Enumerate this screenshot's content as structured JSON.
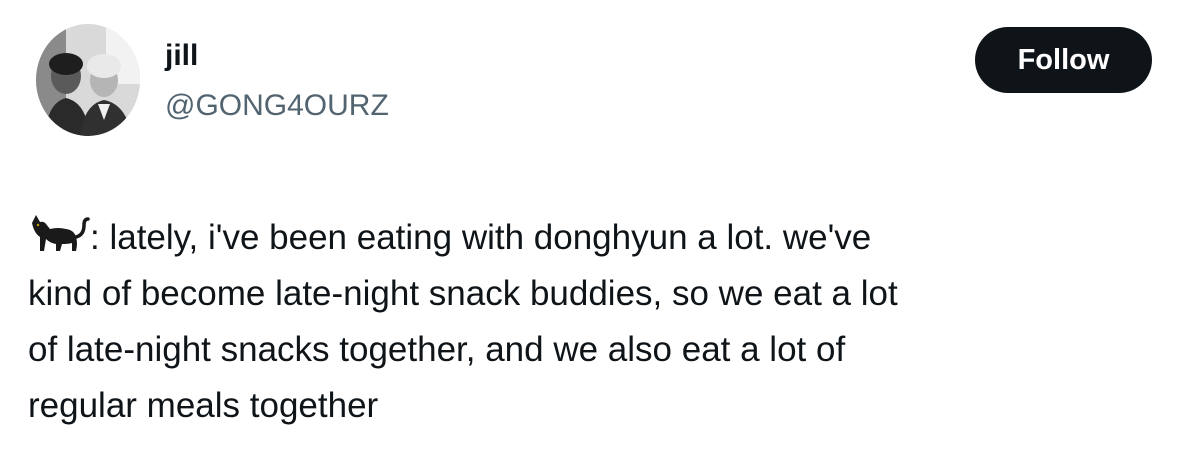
{
  "user": {
    "display_name": "jill",
    "handle": "@GONG4OURZ",
    "avatar_icon": "profile-photo-two-people"
  },
  "follow_button": {
    "label": "Follow",
    "background": "#0f1419",
    "text_color": "#ffffff"
  },
  "tweet": {
    "emoji_icon": "black-cat-emoji",
    "text": ": lately, i've been eating with donghyun a lot. we've\nkind of become late-night snack buddies, so we eat a lot\nof late-night snacks together, and we also eat a lot of\nregular meals together"
  },
  "colors": {
    "text_primary": "#0f1419",
    "text_secondary": "#536471",
    "background": "#ffffff"
  }
}
